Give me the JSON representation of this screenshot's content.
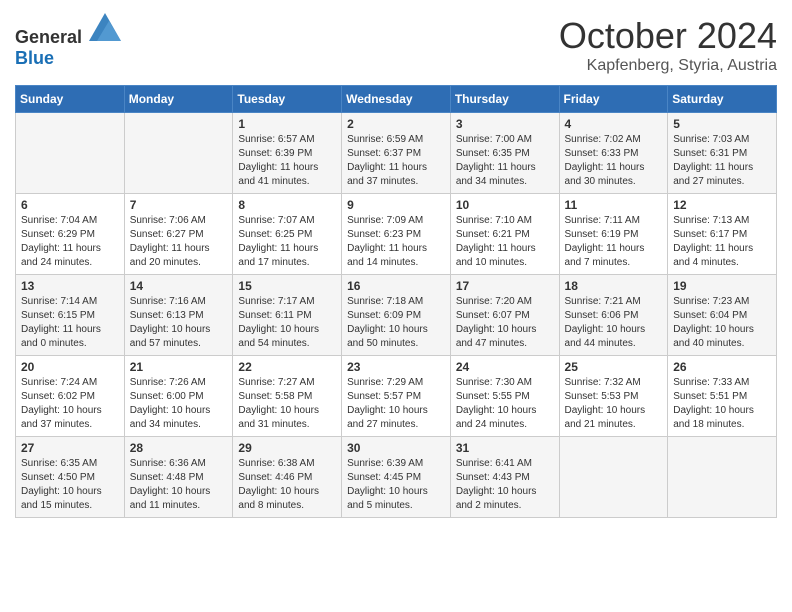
{
  "header": {
    "logo_general": "General",
    "logo_blue": "Blue",
    "month": "October 2024",
    "location": "Kapfenberg, Styria, Austria"
  },
  "days_of_week": [
    "Sunday",
    "Monday",
    "Tuesday",
    "Wednesday",
    "Thursday",
    "Friday",
    "Saturday"
  ],
  "weeks": [
    [
      {
        "day": "",
        "content": ""
      },
      {
        "day": "",
        "content": ""
      },
      {
        "day": "1",
        "content": "Sunrise: 6:57 AM\nSunset: 6:39 PM\nDaylight: 11 hours\nand 41 minutes."
      },
      {
        "day": "2",
        "content": "Sunrise: 6:59 AM\nSunset: 6:37 PM\nDaylight: 11 hours\nand 37 minutes."
      },
      {
        "day": "3",
        "content": "Sunrise: 7:00 AM\nSunset: 6:35 PM\nDaylight: 11 hours\nand 34 minutes."
      },
      {
        "day": "4",
        "content": "Sunrise: 7:02 AM\nSunset: 6:33 PM\nDaylight: 11 hours\nand 30 minutes."
      },
      {
        "day": "5",
        "content": "Sunrise: 7:03 AM\nSunset: 6:31 PM\nDaylight: 11 hours\nand 27 minutes."
      }
    ],
    [
      {
        "day": "6",
        "content": "Sunrise: 7:04 AM\nSunset: 6:29 PM\nDaylight: 11 hours\nand 24 minutes."
      },
      {
        "day": "7",
        "content": "Sunrise: 7:06 AM\nSunset: 6:27 PM\nDaylight: 11 hours\nand 20 minutes."
      },
      {
        "day": "8",
        "content": "Sunrise: 7:07 AM\nSunset: 6:25 PM\nDaylight: 11 hours\nand 17 minutes."
      },
      {
        "day": "9",
        "content": "Sunrise: 7:09 AM\nSunset: 6:23 PM\nDaylight: 11 hours\nand 14 minutes."
      },
      {
        "day": "10",
        "content": "Sunrise: 7:10 AM\nSunset: 6:21 PM\nDaylight: 11 hours\nand 10 minutes."
      },
      {
        "day": "11",
        "content": "Sunrise: 7:11 AM\nSunset: 6:19 PM\nDaylight: 11 hours\nand 7 minutes."
      },
      {
        "day": "12",
        "content": "Sunrise: 7:13 AM\nSunset: 6:17 PM\nDaylight: 11 hours\nand 4 minutes."
      }
    ],
    [
      {
        "day": "13",
        "content": "Sunrise: 7:14 AM\nSunset: 6:15 PM\nDaylight: 11 hours\nand 0 minutes."
      },
      {
        "day": "14",
        "content": "Sunrise: 7:16 AM\nSunset: 6:13 PM\nDaylight: 10 hours\nand 57 minutes."
      },
      {
        "day": "15",
        "content": "Sunrise: 7:17 AM\nSunset: 6:11 PM\nDaylight: 10 hours\nand 54 minutes."
      },
      {
        "day": "16",
        "content": "Sunrise: 7:18 AM\nSunset: 6:09 PM\nDaylight: 10 hours\nand 50 minutes."
      },
      {
        "day": "17",
        "content": "Sunrise: 7:20 AM\nSunset: 6:07 PM\nDaylight: 10 hours\nand 47 minutes."
      },
      {
        "day": "18",
        "content": "Sunrise: 7:21 AM\nSunset: 6:06 PM\nDaylight: 10 hours\nand 44 minutes."
      },
      {
        "day": "19",
        "content": "Sunrise: 7:23 AM\nSunset: 6:04 PM\nDaylight: 10 hours\nand 40 minutes."
      }
    ],
    [
      {
        "day": "20",
        "content": "Sunrise: 7:24 AM\nSunset: 6:02 PM\nDaylight: 10 hours\nand 37 minutes."
      },
      {
        "day": "21",
        "content": "Sunrise: 7:26 AM\nSunset: 6:00 PM\nDaylight: 10 hours\nand 34 minutes."
      },
      {
        "day": "22",
        "content": "Sunrise: 7:27 AM\nSunset: 5:58 PM\nDaylight: 10 hours\nand 31 minutes."
      },
      {
        "day": "23",
        "content": "Sunrise: 7:29 AM\nSunset: 5:57 PM\nDaylight: 10 hours\nand 27 minutes."
      },
      {
        "day": "24",
        "content": "Sunrise: 7:30 AM\nSunset: 5:55 PM\nDaylight: 10 hours\nand 24 minutes."
      },
      {
        "day": "25",
        "content": "Sunrise: 7:32 AM\nSunset: 5:53 PM\nDaylight: 10 hours\nand 21 minutes."
      },
      {
        "day": "26",
        "content": "Sunrise: 7:33 AM\nSunset: 5:51 PM\nDaylight: 10 hours\nand 18 minutes."
      }
    ],
    [
      {
        "day": "27",
        "content": "Sunrise: 6:35 AM\nSunset: 4:50 PM\nDaylight: 10 hours\nand 15 minutes."
      },
      {
        "day": "28",
        "content": "Sunrise: 6:36 AM\nSunset: 4:48 PM\nDaylight: 10 hours\nand 11 minutes."
      },
      {
        "day": "29",
        "content": "Sunrise: 6:38 AM\nSunset: 4:46 PM\nDaylight: 10 hours\nand 8 minutes."
      },
      {
        "day": "30",
        "content": "Sunrise: 6:39 AM\nSunset: 4:45 PM\nDaylight: 10 hours\nand 5 minutes."
      },
      {
        "day": "31",
        "content": "Sunrise: 6:41 AM\nSunset: 4:43 PM\nDaylight: 10 hours\nand 2 minutes."
      },
      {
        "day": "",
        "content": ""
      },
      {
        "day": "",
        "content": ""
      }
    ]
  ]
}
